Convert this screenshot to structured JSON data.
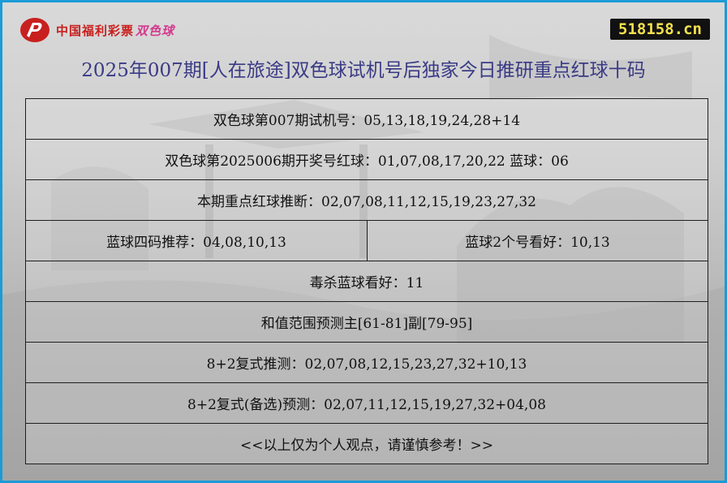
{
  "logo": {
    "org_text": "中国福利彩票",
    "brand_text": "双色球"
  },
  "site_badge": "518158.cn",
  "title": "2025年007期[人在旅途]双色球试机号后独家今日推研重点红球十码",
  "rows": [
    {
      "cells": [
        "双色球第007期试机号：05,13,18,19,24,28+14"
      ]
    },
    {
      "cells": [
        "双色球第2025006期开奖号红球：01,07,08,17,20,22 蓝球：06"
      ]
    },
    {
      "cells": [
        "本期重点红球推断：02,07,08,11,12,15,19,23,27,32"
      ]
    },
    {
      "cells": [
        "蓝球四码推荐：04,08,10,13",
        "蓝球2个号看好：10,13"
      ]
    },
    {
      "cells": [
        "毒杀蓝球看好：11"
      ]
    },
    {
      "cells": [
        "和值范围预测主[61-81]副[79-95]"
      ]
    },
    {
      "cells": [
        "8+2复式推测：02,07,08,12,15,23,27,32+10,13"
      ]
    },
    {
      "cells": [
        "8+2复式(备选)预测：02,07,11,12,15,19,27,32+04,08"
      ]
    },
    {
      "cells": [
        "<<以上仅为个人观点，请谨慎参考！>>"
      ]
    }
  ],
  "colors": {
    "frame_border": "#1a9bd8",
    "title": "#3a3a86",
    "logo_red": "#c8201e",
    "logo_brand": "#d33a8d",
    "badge_bg": "#111111",
    "badge_text": "#f4e04d"
  }
}
